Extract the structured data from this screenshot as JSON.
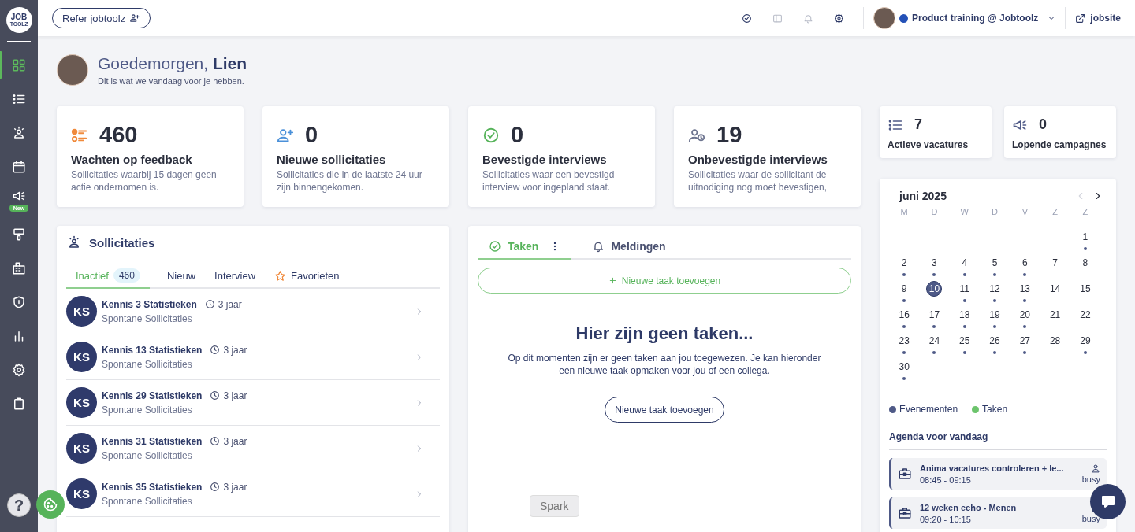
{
  "sidebar": {
    "logo_top": "JOB",
    "logo_bottom": "TOOLZ",
    "items": [
      {
        "kind": "dashboard",
        "selected": true
      },
      {
        "kind": "list",
        "selected": false
      },
      {
        "kind": "person",
        "selected": false
      },
      {
        "kind": "calendar",
        "selected": false
      },
      {
        "kind": "megaphone",
        "selected": false,
        "badge": "New"
      },
      {
        "kind": "roller",
        "selected": false
      },
      {
        "kind": "building",
        "selected": false
      },
      {
        "kind": "shield",
        "selected": false
      },
      {
        "kind": "chart",
        "selected": false
      },
      {
        "kind": "gear",
        "selected": false
      },
      {
        "kind": "clipboard",
        "selected": false
      }
    ],
    "help": "?"
  },
  "topbar": {
    "refer_button": "Refer jobtoolz",
    "account": "Product training @ Jobtoolz",
    "jobsite_link": "jobsite"
  },
  "greeting": {
    "title": "Goedemorgen, **Lien**",
    "subtitle": "Dit is wat we vandaag voor je hebben."
  },
  "stats": [
    {
      "kind": "feedback",
      "value": "460",
      "title": "Wachten op feedback",
      "description": "Sollicitaties waarbij 15 dagen geen actie ondernomen is."
    },
    {
      "kind": "new",
      "value": "0",
      "title": "Nieuwe sollicitaties",
      "description": "Sollicitaties die in de laatste 24 uur zijn binnengekomen."
    },
    {
      "kind": "confirmed",
      "value": "0",
      "title": "Bevestigde interviews",
      "description": "Sollicitaties waar een bevestigd interview voor ingepland staat."
    },
    {
      "kind": "unconfirmed",
      "value": "19",
      "title": "Onbevestigde interviews",
      "description": "Sollicitaties waar de sollicitant de uitnodiging nog moet bevestigen,"
    }
  ],
  "mini_stats": [
    {
      "kind": "vacancies",
      "value": "7",
      "label": "Actieve vacatures"
    },
    {
      "kind": "campaigns",
      "value": "0",
      "label": "Lopende campagnes"
    }
  ],
  "applications": {
    "title": "Sollicitaties",
    "tabs": [
      {
        "label": "Inactief",
        "count": "460",
        "selected": true
      },
      {
        "label": "Nieuw",
        "selected": false
      },
      {
        "label": "Interview",
        "selected": false
      },
      {
        "label": "Favorieten",
        "kind": "star",
        "selected": false
      }
    ],
    "rows": [
      {
        "initials": "KS",
        "name": "Kennis 3 Statistieken",
        "age": "3 jaar",
        "source": "Spontane Sollicitaties"
      },
      {
        "initials": "KS",
        "name": "Kennis 13 Statistieken",
        "age": "3 jaar",
        "source": "Spontane Sollicitaties"
      },
      {
        "initials": "KS",
        "name": "Kennis 29 Statistieken",
        "age": "3 jaar",
        "source": "Spontane Sollicitaties"
      },
      {
        "initials": "KS",
        "name": "Kennis 31 Statistieken",
        "age": "3 jaar",
        "source": "Spontane Sollicitaties"
      },
      {
        "initials": "KS",
        "name": "Kennis 35 Statistieken",
        "age": "3 jaar",
        "source": "Spontane Sollicitaties"
      }
    ]
  },
  "tasks": {
    "tabs": [
      {
        "label": "Taken",
        "kind": "check",
        "selected": true
      },
      {
        "label": "Meldingen",
        "kind": "bell",
        "selected": false
      }
    ],
    "add_button": "Nieuwe taak toevoegen",
    "empty_title": "Hier zijn geen taken...",
    "empty_text": "Op dit momenten zijn er geen taken aan jou toegewezen. Je kan hieronder een nieuwe taak opmaken voor jou of een collega.",
    "empty_button": "Nieuwe taak toevoegen"
  },
  "calendar": {
    "month": "juni 2025",
    "prev_disabled": true,
    "next_disabled": false,
    "weekdays": [
      "M",
      "D",
      "W",
      "D",
      "V",
      "Z",
      "Z"
    ],
    "weeks": [
      [
        {
          "day": "1",
          "events": true,
          "selected": false
        }
      ],
      [
        {
          "day": "2",
          "events": true,
          "selected": false
        },
        {
          "day": "3",
          "events": true,
          "selected": false
        },
        {
          "day": "4",
          "events": true,
          "selected": false
        },
        {
          "day": "5",
          "events": true,
          "selected": false
        },
        {
          "day": "6",
          "events": true,
          "selected": false
        },
        {
          "day": "7",
          "events": false,
          "selected": false
        },
        {
          "day": "8",
          "events": false,
          "selected": false
        }
      ],
      [
        {
          "day": "9",
          "events": true,
          "selected": false
        },
        {
          "day": "10",
          "events": false,
          "selected": true
        },
        {
          "day": "11",
          "events": true,
          "selected": false
        },
        {
          "day": "12",
          "events": true,
          "selected": false
        },
        {
          "day": "13",
          "events": true,
          "selected": false
        },
        {
          "day": "14",
          "events": false,
          "selected": false
        },
        {
          "day": "15",
          "events": false,
          "selected": false
        }
      ],
      [
        {
          "day": "16",
          "events": true,
          "selected": false
        },
        {
          "day": "17",
          "events": true,
          "selected": false
        },
        {
          "day": "18",
          "events": true,
          "selected": false
        },
        {
          "day": "19",
          "events": true,
          "selected": false
        },
        {
          "day": "20",
          "events": true,
          "selected": false
        },
        {
          "day": "21",
          "events": false,
          "selected": false
        },
        {
          "day": "22",
          "events": false,
          "selected": false
        }
      ],
      [
        {
          "day": "23",
          "events": true,
          "selected": false
        },
        {
          "day": "24",
          "events": true,
          "selected": false
        },
        {
          "day": "25",
          "events": true,
          "selected": false
        },
        {
          "day": "26",
          "events": true,
          "selected": false
        },
        {
          "day": "27",
          "events": true,
          "selected": false
        },
        {
          "day": "28",
          "events": false,
          "selected": false
        },
        {
          "day": "29",
          "events": true,
          "selected": false
        }
      ],
      [
        {
          "day": "30",
          "events": true,
          "selected": false
        }
      ]
    ],
    "legend": [
      {
        "label": "Evenementen",
        "color": "#4f5a87"
      },
      {
        "label": "Taken",
        "color": "#6cc46c"
      }
    ],
    "agenda_title": "Agenda voor vandaag",
    "agenda": [
      {
        "title": "Anima vacatures controleren + le...",
        "time": "08:45 - 09:15",
        "status": "busy"
      },
      {
        "title": "12 weken echo - Menen",
        "time": "09:20 - 10:15",
        "status": "busy"
      }
    ]
  },
  "tooltip": "Spark"
}
